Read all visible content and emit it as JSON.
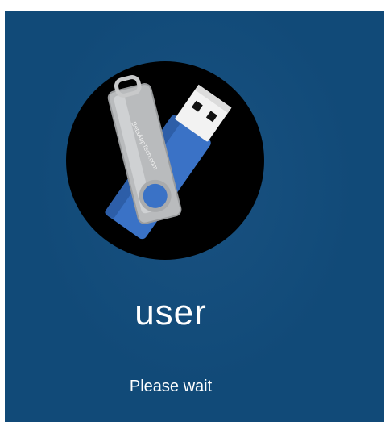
{
  "login": {
    "avatar_icon": "usb-flash-drive-icon",
    "avatar_brand_text": "BetaAppTech.com",
    "username": "user",
    "status": "Please wait"
  },
  "colors": {
    "background": "#114a78",
    "text": "#ffffff",
    "avatar_bg": "#000000",
    "drive_blue": "#3a72c6",
    "drive_silver": "#b9bbbd"
  }
}
